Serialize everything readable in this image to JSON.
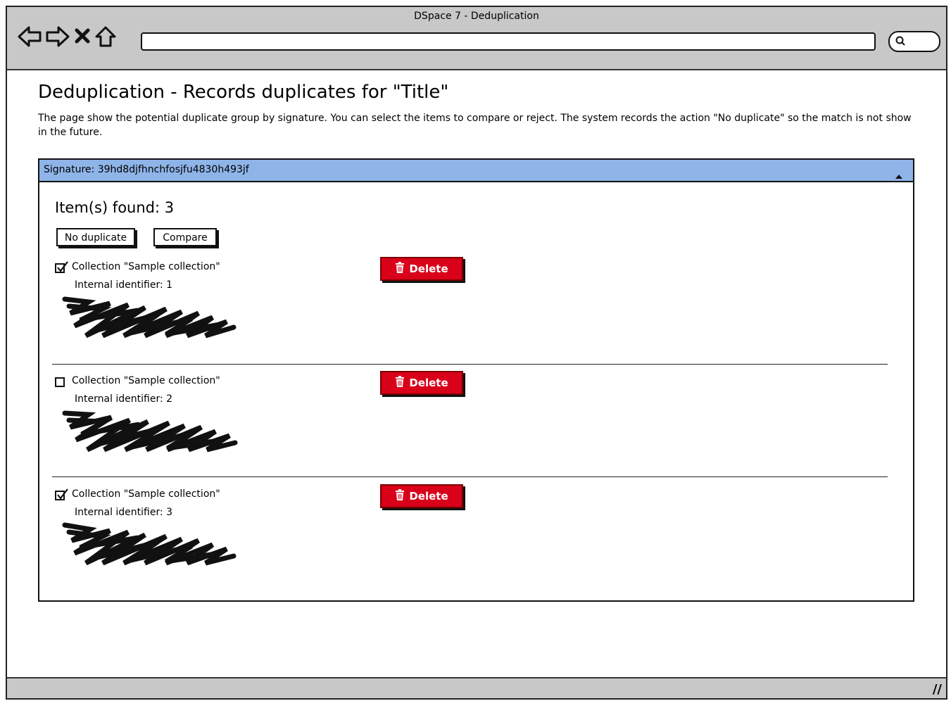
{
  "window": {
    "title": "DSpace 7 - Deduplication"
  },
  "page": {
    "title": "Deduplication - Records duplicates for \"Title\"",
    "description": "The page show the potential duplicate group by signature. You can select the items to compare or reject. The system records the action \"No duplicate\" so the match is not show in the future."
  },
  "group": {
    "signature_label": "Signature: 39hd8djfhnchfosjfu4830h493jf",
    "found_label": "Item(s) found: 3",
    "no_duplicate_label": "No duplicate",
    "compare_label": "Compare",
    "items": [
      {
        "checked": true,
        "collection": "Collection \"Sample collection\"",
        "identifier": "Internal identifier: 1",
        "delete_label": "Delete"
      },
      {
        "checked": false,
        "collection": "Collection \"Sample collection\"",
        "identifier": "Internal identifier: 2",
        "delete_label": "Delete"
      },
      {
        "checked": true,
        "collection": "Collection \"Sample collection\"",
        "identifier": "Internal identifier: 3",
        "delete_label": "Delete"
      }
    ]
  },
  "colors": {
    "header": "#8eb4e8",
    "delete": "#d9001a",
    "chrome": "#c8c8c8"
  },
  "icons": [
    "back-icon",
    "forward-icon",
    "stop-icon",
    "home-icon",
    "search-icon",
    "collapse-up-icon",
    "trash-icon",
    "checkmark-icon"
  ]
}
